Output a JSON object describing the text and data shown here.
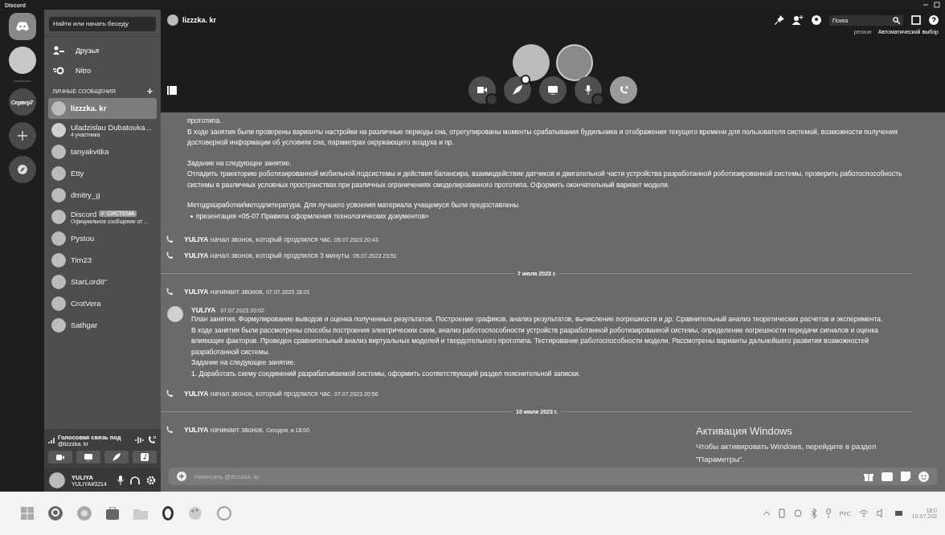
{
  "window": {
    "title": "Discord"
  },
  "servers": [
    {
      "kind": "home",
      "selected": true
    },
    {
      "kind": "avatar",
      "selected": false
    },
    {
      "kind": "text",
      "label": "Сервер7",
      "selected": false
    },
    {
      "kind": "add"
    },
    {
      "kind": "explore"
    }
  ],
  "sidebar": {
    "search": {
      "placeholder": "Найти или начать беседу"
    },
    "nav": [
      {
        "kind": "friends",
        "label": "Друзья"
      },
      {
        "kind": "nitro",
        "label": "Nitro"
      }
    ],
    "section": {
      "title": "ЛИЧНЫЕ СООБЩЕНИЯ",
      "add": "+"
    },
    "dms": [
      {
        "name": "lizzzka. kr",
        "selected": true,
        "kind": "photo"
      },
      {
        "name": "Uladzislau Dubatouka...",
        "subtitle": "4 участника",
        "selected": false,
        "kind": "group"
      },
      {
        "name": "tanyakvitka",
        "selected": false,
        "kind": "photo"
      },
      {
        "name": "Etty",
        "selected": false,
        "kind": "photo"
      },
      {
        "name": "dmitry_g",
        "selected": false,
        "kind": "photo"
      },
      {
        "name": "Discord",
        "badge": "✓ СИСТЕМА",
        "subtitle": "Официальное сообщение от ...",
        "selected": false,
        "kind": "bot"
      },
      {
        "name": "Pystou",
        "selected": false,
        "kind": "photo"
      },
      {
        "name": "Tim23",
        "selected": false,
        "kind": "bot"
      },
      {
        "name": "StarLord8\"",
        "selected": false,
        "kind": "photo"
      },
      {
        "name": "CrotVera",
        "selected": false,
        "kind": "photo"
      },
      {
        "name": "Sathgar",
        "selected": false,
        "kind": "bot"
      }
    ],
    "voice": {
      "status": "Голосовая связь под",
      "channel": "@lizzzka. kr"
    },
    "user": {
      "name": "YULIYA",
      "tag": "YULIYA#3214"
    }
  },
  "header": {
    "channel": "lizzzka. kr",
    "search": {
      "placeholder": "Поиск"
    },
    "region_label": "регион",
    "region_value": "Автоматический выбор"
  },
  "messages": [
    {
      "kind": "text",
      "groups": [
        {
          "lines": [
            "прототипа.",
            "В ходе занятия были проверены варианты настройки на различные периоды сна, отрегулированы моменты срабатывания будильника и отображения текущего времени для пользователя системой, возможности получения достоверной информации об условиях сна, параметрах окружающего воздуха и пр."
          ]
        },
        {
          "lines": [
            "Задание на следующее занятие.",
            "Отладить траекторию роботизированной мобильной подсистемы и действия балансира, взаимодействие датчиков и двигательной части устройства разработанной роботизированной системы, проверить работоспособность системы в различных условных пространствах при различных ограничениях смоделированного прототипа. Оформить окончательный вариант модели."
          ]
        },
        {
          "lines": [
            "Методразработки/методлитература. Для лучшего усвоения материала учащемуся были предоставлены"
          ],
          "bullets": [
            "презентация «05-07 Правила оформления технологических документов»"
          ]
        }
      ]
    },
    {
      "kind": "call",
      "author": "YULIYA",
      "text": "начал звонок, который продлился час.",
      "time": "05.07.2023 20:43"
    },
    {
      "kind": "call",
      "author": "YULIYA",
      "text": "начал звонок, который продлился 3 минуты.",
      "time": "05.07.2023 23:51"
    },
    {
      "kind": "divider",
      "text": "7 июля 2023 г."
    },
    {
      "kind": "call",
      "author": "YULIYA",
      "text": "начинает звонок.",
      "time": "07.07.2023 18:01"
    },
    {
      "kind": "message",
      "author": "YULIYA",
      "time": "07.07.2023 20:02",
      "lines": [
        "План занятия. Формулирование выводов и оценка полученных результатов. Построение графиков, анализ результатов, вычисление погрешности и др. Сравнительный анализ теоретических расчетов и эксперимента.",
        "В ходе занятия были рассмотрены способы построения электрических схем, анализ работоспособности устройств разработанной роботизированной системы, определение погрешности передачи сигналов и оценка влияющих факторов. Проведен сравнительный анализ виртуальных моделей и твердотельного прототипа. Тестирование работоспособности модели. Рассмотрены варианты дальнейшего развития возможностей разработанной системы.",
        "Задание на следующее занятие.",
        "1. Доработать схему соединений разрабатываемой системы, оформить соответствующий раздел пояснительной записки."
      ]
    },
    {
      "kind": "call",
      "author": "YULIYA",
      "text": "начал звонок, который продлился час.",
      "time": "07.07.2023 20:56"
    },
    {
      "kind": "divider",
      "text": "10 июля 2023 г."
    },
    {
      "kind": "call",
      "author": "YULIYA",
      "text": "начинает звонок.",
      "time": "Сегодня, в 18:00"
    }
  ],
  "composer": {
    "placeholder": "Написать @lizzzka. kr"
  },
  "activation": {
    "title": "Активация Windows",
    "text": "Чтобы активировать Windows, перейдите в раздел \"Параметры\"."
  },
  "taskbar": {
    "language": "РУС",
    "time": "18:0",
    "date": "10.07.202"
  }
}
